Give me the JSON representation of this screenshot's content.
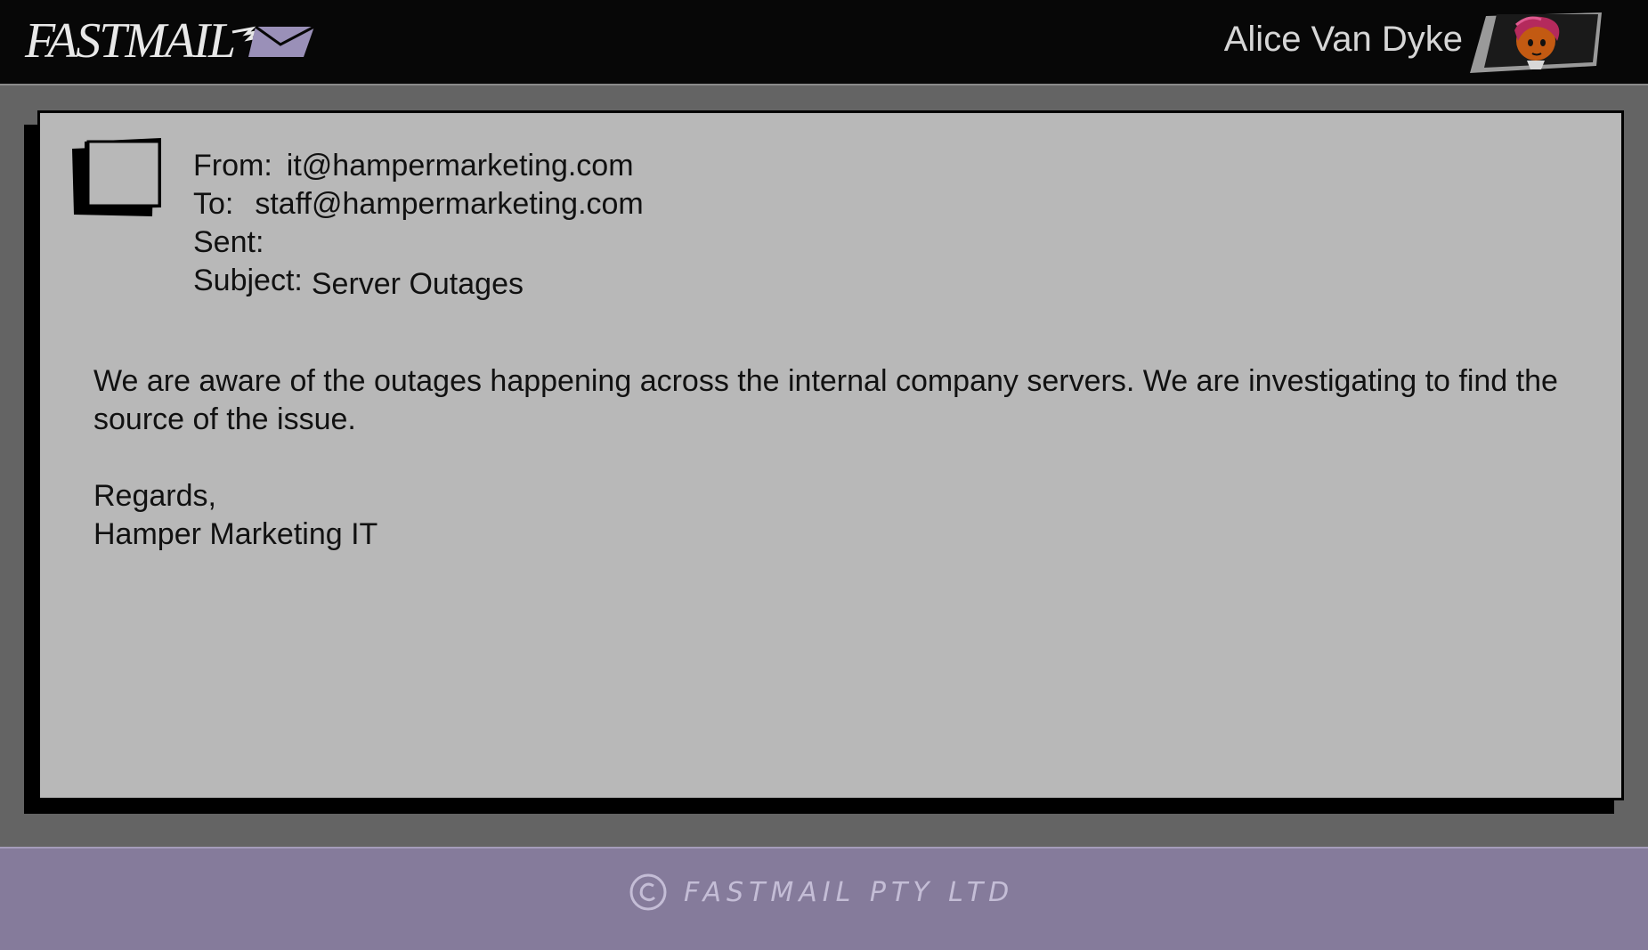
{
  "app": {
    "logo_text": "FASTMAIL",
    "accent_color": "#857b9b"
  },
  "user": {
    "name": "Alice Van Dyke"
  },
  "email": {
    "from_label": "From:",
    "from_value": "it@hampermarketing.com",
    "to_label": "To:",
    "to_value": "staff@hampermarketing.com",
    "sent_label": "Sent:",
    "sent_value": "",
    "subject_label": "Subject:",
    "subject_value": "Server Outages",
    "body": "We are aware of the outages happening across the internal company servers. We are investigating to find the source of the issue.",
    "closing": "Regards,",
    "signature": "Hamper Marketing IT"
  },
  "footer": {
    "copyright_text": "FASTMAIL PTY LTD"
  },
  "icons": [
    "envelope-icon",
    "avatar",
    "sender-avatar-icon",
    "copyright-icon"
  ]
}
